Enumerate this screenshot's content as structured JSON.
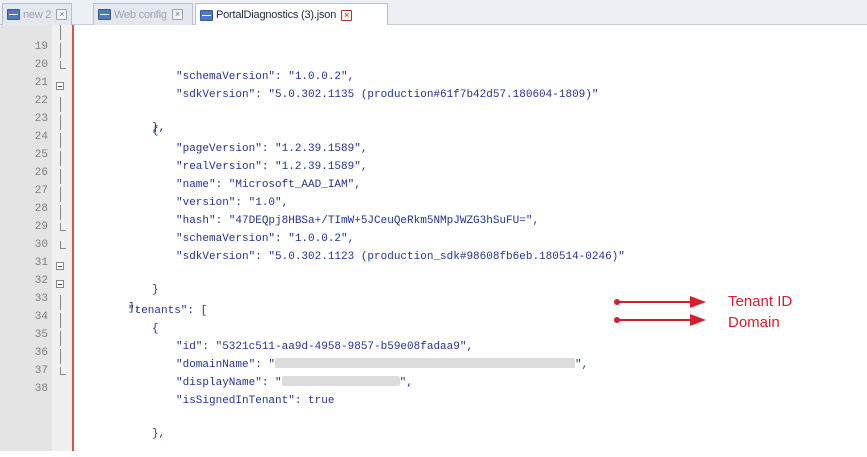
{
  "tabs": [
    {
      "label": "new 2",
      "active": false
    },
    {
      "label": "Web config",
      "active": false
    },
    {
      "label": "PortalDiagnostics (3).json",
      "active": true
    }
  ],
  "lines": [
    {
      "n": "19",
      "text": "\"schemaVersion\": \"1.0.0.2\","
    },
    {
      "n": "20",
      "text": "\"sdkVersion\": \"5.0.302.1135 (production#61f7b42d57.180604-1809)\""
    },
    {
      "n": "21",
      "text": "},"
    },
    {
      "n": "22",
      "text": "{"
    },
    {
      "n": "23",
      "text": "\"pageVersion\": \"1.2.39.1589\","
    },
    {
      "n": "24",
      "text": "\"realVersion\": \"1.2.39.1589\","
    },
    {
      "n": "25",
      "text": "\"name\": \"Microsoft_AAD_IAM\","
    },
    {
      "n": "26",
      "text": "\"version\": \"1.0\","
    },
    {
      "n": "27",
      "text": "\"hash\": \"47DEQpj8HBSa+/TImW+5JCeuQeRkm5NMpJWZG3hSuFU=\","
    },
    {
      "n": "28",
      "text": "\"schemaVersion\": \"1.0.0.2\","
    },
    {
      "n": "29",
      "text": "\"sdkVersion\": \"5.0.302.1123 (production_sdk#98608fb6eb.180514-0246)\""
    },
    {
      "n": "30",
      "text": "}"
    },
    {
      "n": "31",
      "text": "],"
    },
    {
      "n": "32",
      "text": "\"tenants\": ["
    },
    {
      "n": "33",
      "text": "{"
    },
    {
      "n": "34",
      "text": "\"id\": \"5321c511-aa9d-4958-9857-b59e08fadaa9\","
    },
    {
      "n": "35",
      "text_pre": "\"domainName\": \"",
      "text_post": "\","
    },
    {
      "n": "36",
      "text_pre": "\"displayName\": \"",
      "text_post": "\","
    },
    {
      "n": "37",
      "text": "\"isSignedInTenant\": true"
    },
    {
      "n": "38",
      "text": "},"
    }
  ],
  "annotations": {
    "tenant_id": "Tenant ID",
    "domain": "Domain"
  },
  "colors": {
    "arrow": "#d0222e",
    "fold_bar": "#d9534f"
  }
}
